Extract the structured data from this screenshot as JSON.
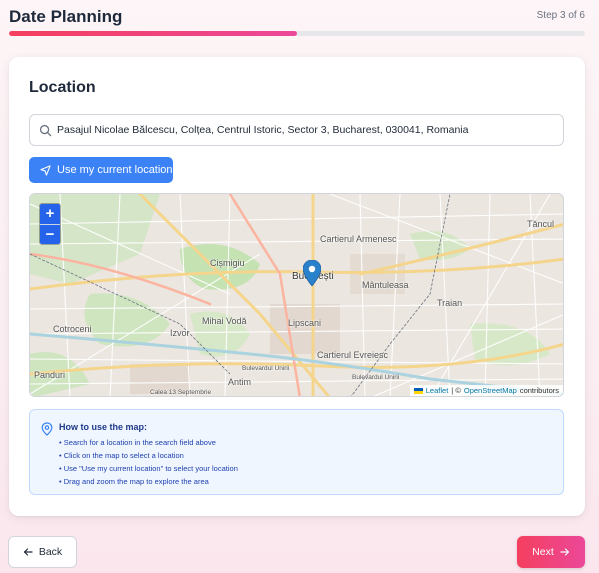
{
  "header": {
    "title": "Date Planning",
    "step_label": "Step 3 of 6",
    "progress": 0.5
  },
  "location": {
    "title": "Location",
    "search_value": "Pasajul Nicolae Bălcescu, Colțea, Centrul Istoric, Sector 3, Bucharest, 030041, Romania",
    "use_location_label": "Use my current location"
  },
  "map": {
    "zoom_in": "+",
    "zoom_out": "−",
    "labels": {
      "armenesc": "Cartierul Armenesc",
      "tei": "Tăncul",
      "cismigiu": "Cișmigiu",
      "bucuresti": "București",
      "mantuleasa": "Mântuleasa",
      "traian": "Traian",
      "cotroceni": "Cotroceni",
      "mihai_voda": "Mihai Vodă",
      "lipscani": "Lipscani",
      "izvor": "Izvor",
      "evreiesc": "Cartierul Evreiesc",
      "panduri": "Panduri",
      "antim": "Antim",
      "unirii": "Bulevardul Unirii",
      "unirii2": "Bulevardul Unirii",
      "sept13": "Calea 13 Septembrie"
    },
    "attribution": {
      "leaflet": "Leaflet",
      "sep": "| ©",
      "osm": "OpenStreetMap",
      "contributors": "contributors"
    }
  },
  "help": {
    "title": "How to use the map:",
    "items": [
      "Search for a location in the search field above",
      "Click on the map to select a location",
      "Use \"Use my current location\" to select your location",
      "Drag and zoom the map to explore the area"
    ]
  },
  "nav": {
    "back_label": "Back",
    "next_label": "Next"
  },
  "colors": {
    "accent_start": "#f43f5e",
    "accent_end": "#ec4899",
    "primary_blue": "#3b82f6"
  }
}
